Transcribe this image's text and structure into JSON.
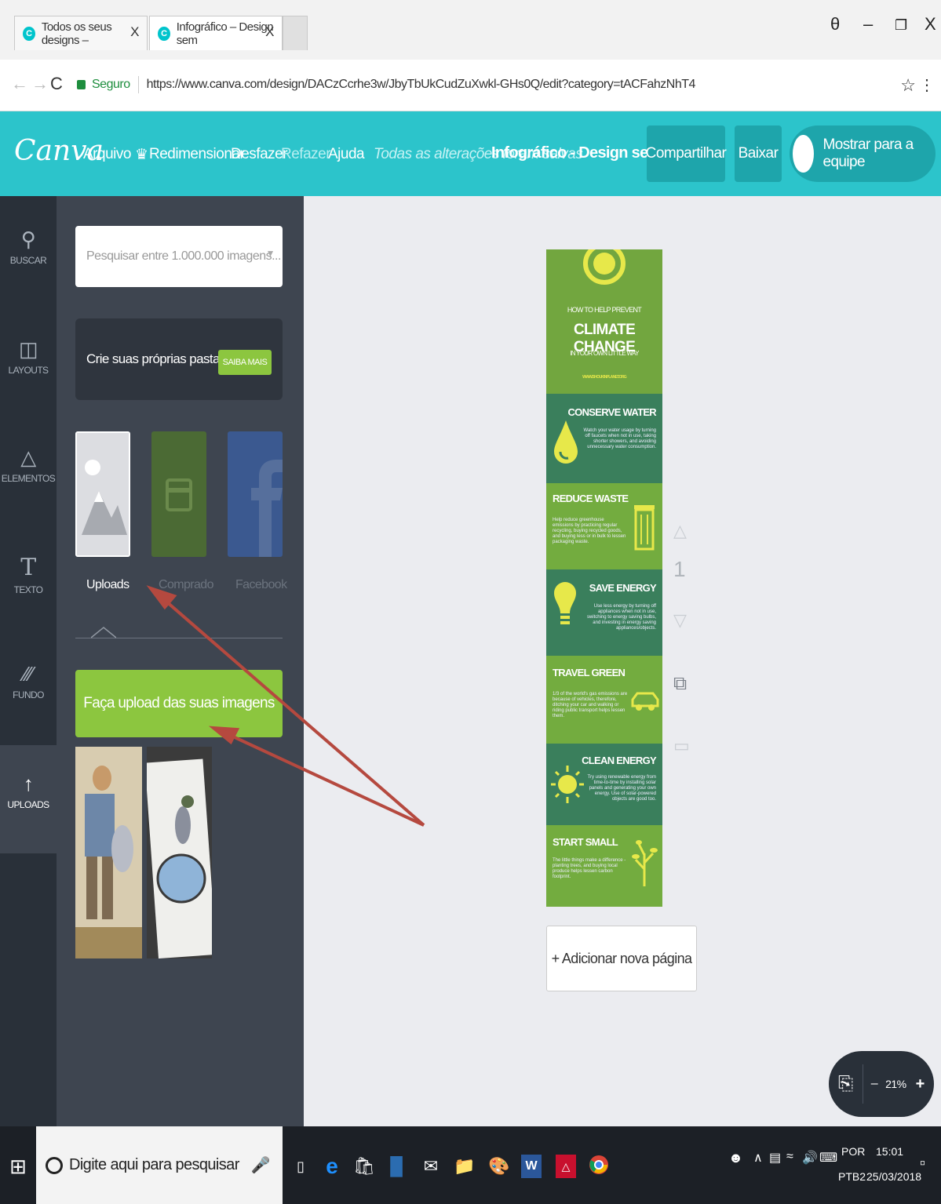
{
  "browser": {
    "tabs": [
      {
        "title": "Todos os seus designs –",
        "close": "X"
      },
      {
        "title": "Infográfico – Design sem",
        "close": "X"
      }
    ],
    "window_controls": {
      "account": "θ",
      "minimize": "–",
      "restore": "❐",
      "close": "X"
    },
    "security_label": "Seguro",
    "url": "https://www.canva.com/design/DACzCcrhe3w/JbyTbUkCudZuXwkl-GHs0Q/edit?category=tACFahzNhT4"
  },
  "header": {
    "logo": "Canva",
    "menu": {
      "file": "Arquivo",
      "resize": "Redimensionar",
      "undo": "Desfazer",
      "redo": "Refazer",
      "help": "Ajuda"
    },
    "saved_status": "Todas as alterações foram salvas",
    "doc_title": "Infográfico - Design sem nome",
    "share": "Compartilhar",
    "download": "Baixar",
    "present_team": "Mostrar para a equipe"
  },
  "sidebar": {
    "items": [
      {
        "label": "BUSCAR",
        "icon": "search-icon"
      },
      {
        "label": "LAYOUTS",
        "icon": "layouts-icon"
      },
      {
        "label": "ELEMENTOS",
        "icon": "elements-icon"
      },
      {
        "label": "TEXTO",
        "icon": "text-icon"
      },
      {
        "label": "FUNDO",
        "icon": "background-icon"
      },
      {
        "label": "UPLOADS",
        "icon": "upload-icon"
      }
    ]
  },
  "panel": {
    "search_placeholder": "Pesquisar entre 1.000.000 imagens...",
    "folders_text": "Crie suas próprias pastas",
    "folders_button": "SAIBA MAIS",
    "categories": [
      "Uploads",
      "Comprado",
      "Facebook"
    ],
    "upload_button": "Faça upload das suas imagens"
  },
  "infographic": {
    "title_small": "HOW TO HELP PREVENT",
    "title_big": "CLIMATE CHANGE",
    "title_sub": "IN YOUR OWN LITTLE WAY",
    "site": "WWW.SHOUKINPLANET.ORG",
    "sections": [
      {
        "heading": "CONSERVE WATER",
        "text": "Watch your water usage by turning off faucets when not in use, taking shorter showers, and avoiding unnecessary water consumption."
      },
      {
        "heading": "REDUCE WASTE",
        "text": "Help reduce greenhouse emissions by practicing regular recycling, buying recycled goods, and buying less or in bulk to lessen packaging waste."
      },
      {
        "heading": "SAVE ENERGY",
        "text": "Use less energy by turning off appliances when not in use, switching to energy saving bulbs, and investing in energy saving appliances/objects."
      },
      {
        "heading": "TRAVEL GREEN",
        "text": "1/3 of the world's gas emissions are because of vehicles, therefore, ditching your car and walking or riding public transport helps lessen them."
      },
      {
        "heading": "CLEAN ENERGY",
        "text": "Try using renewable energy from time-to-time by installing solar panels and generating your own energy. Use of solar-powered objects are good too."
      },
      {
        "heading": "START SMALL",
        "text": "The little things make a difference - planting trees, and buying local produce helps lessen carbon footprint."
      }
    ]
  },
  "canvas": {
    "page_number": "1",
    "add_page": "+ Adicionar nova página",
    "zoom": "21%",
    "zoom_minus": "–",
    "zoom_plus": "+"
  },
  "taskbar": {
    "search_placeholder": "Digite aqui para pesquisar",
    "lang": "POR",
    "keyboard": "PTB2",
    "time": "15:01",
    "date": "25/03/2018"
  },
  "colors": {
    "canva_teal": "#2cc4cb",
    "canva_green": "#8cc63f",
    "sidebar_dark": "#293039",
    "panel_dark": "#3e4550",
    "annotation_arrow": "#b5493f"
  }
}
